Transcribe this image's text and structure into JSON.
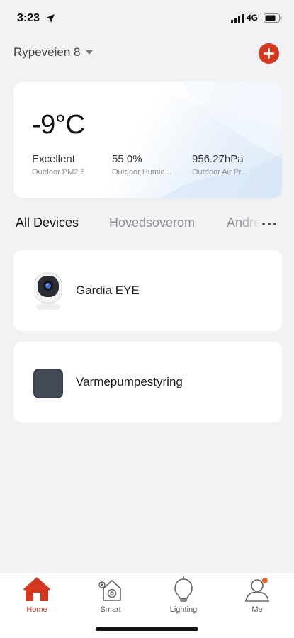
{
  "status": {
    "time": "3:23",
    "network": "4G"
  },
  "header": {
    "home_name": "Rypeveien 8"
  },
  "weather": {
    "temperature": "-9°C",
    "metrics": [
      {
        "value": "Excellent",
        "label": "Outdoor PM2.5"
      },
      {
        "value": "55.0%",
        "label": "Outdoor Humid..."
      },
      {
        "value": "956.27hPa",
        "label": "Outdoor Air Pr..."
      }
    ]
  },
  "tabs": [
    "All Devices",
    "Hovedsoverom",
    "Andre"
  ],
  "devices": [
    {
      "name": "Gardia EYE",
      "icon": "camera-icon"
    },
    {
      "name": "Varmepumpestyring",
      "icon": "hub-icon"
    }
  ],
  "tabbar": {
    "items": [
      {
        "label": "Home",
        "icon": "home-icon",
        "active": true
      },
      {
        "label": "Smart",
        "icon": "smart-icon",
        "active": false
      },
      {
        "label": "Lighting",
        "icon": "bulb-icon",
        "active": false
      },
      {
        "label": "Me",
        "icon": "profile-icon",
        "active": false
      }
    ]
  },
  "colors": {
    "accent": "#d4391f",
    "background": "#f2f2f4",
    "card": "#ffffff"
  }
}
